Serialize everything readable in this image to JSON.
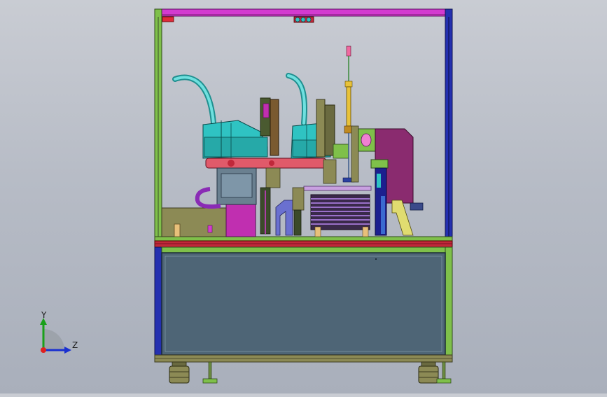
{
  "scene": {
    "colors": {
      "background_top": "#c9ccd3",
      "background_bottom": "#a9afbb",
      "frame_green": "#7fc04a",
      "frame_dark": "#3b4a2a",
      "beam_magenta": "#d33bd0",
      "beam_red": "#c0283a",
      "beam_navy": "#1c1f8f",
      "cabinet_panel": "#4e6576",
      "robot_cyan": "#2fc3c2",
      "robot_arm_red": "#e05a6a",
      "purple": "#8a2b8f",
      "olive": "#8c8a55",
      "yellow": "#e8c23a"
    }
  },
  "triad": {
    "y_label": "Y",
    "z_label": "Z"
  }
}
